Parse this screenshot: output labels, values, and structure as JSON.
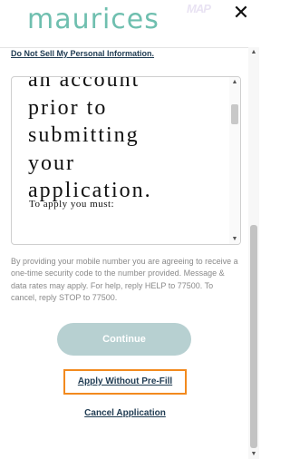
{
  "header": {
    "logo_text": "maurices",
    "watermark_text": "MAP",
    "close_icon": "close-icon",
    "close_glyph": "✕"
  },
  "privacy_link": "Do Not Sell My Personal Information.",
  "terms": {
    "partial_line": "an account",
    "large_lines": [
      "prior to",
      "submitting",
      "your",
      "application."
    ],
    "small_line": "To apply you must:"
  },
  "disclaimer": "By providing your mobile number you are agreeing to receive a one-time security code to the number provided. Message & data rates may apply. For help, reply HELP to 77500. To cancel, reply STOP to 77500.",
  "buttons": {
    "continue_label": "Continue",
    "apply_without_prefill_label": "Apply Without Pre-Fill",
    "cancel_application_label": "Cancel Application"
  },
  "scrollbars": {
    "up_glyph": "▲",
    "down_glyph": "▼"
  },
  "colors": {
    "brand": "#6fbfaf",
    "link": "#1f3b52",
    "continue_disabled": "#b7d0d1",
    "focus_outline": "#f28a1e"
  }
}
